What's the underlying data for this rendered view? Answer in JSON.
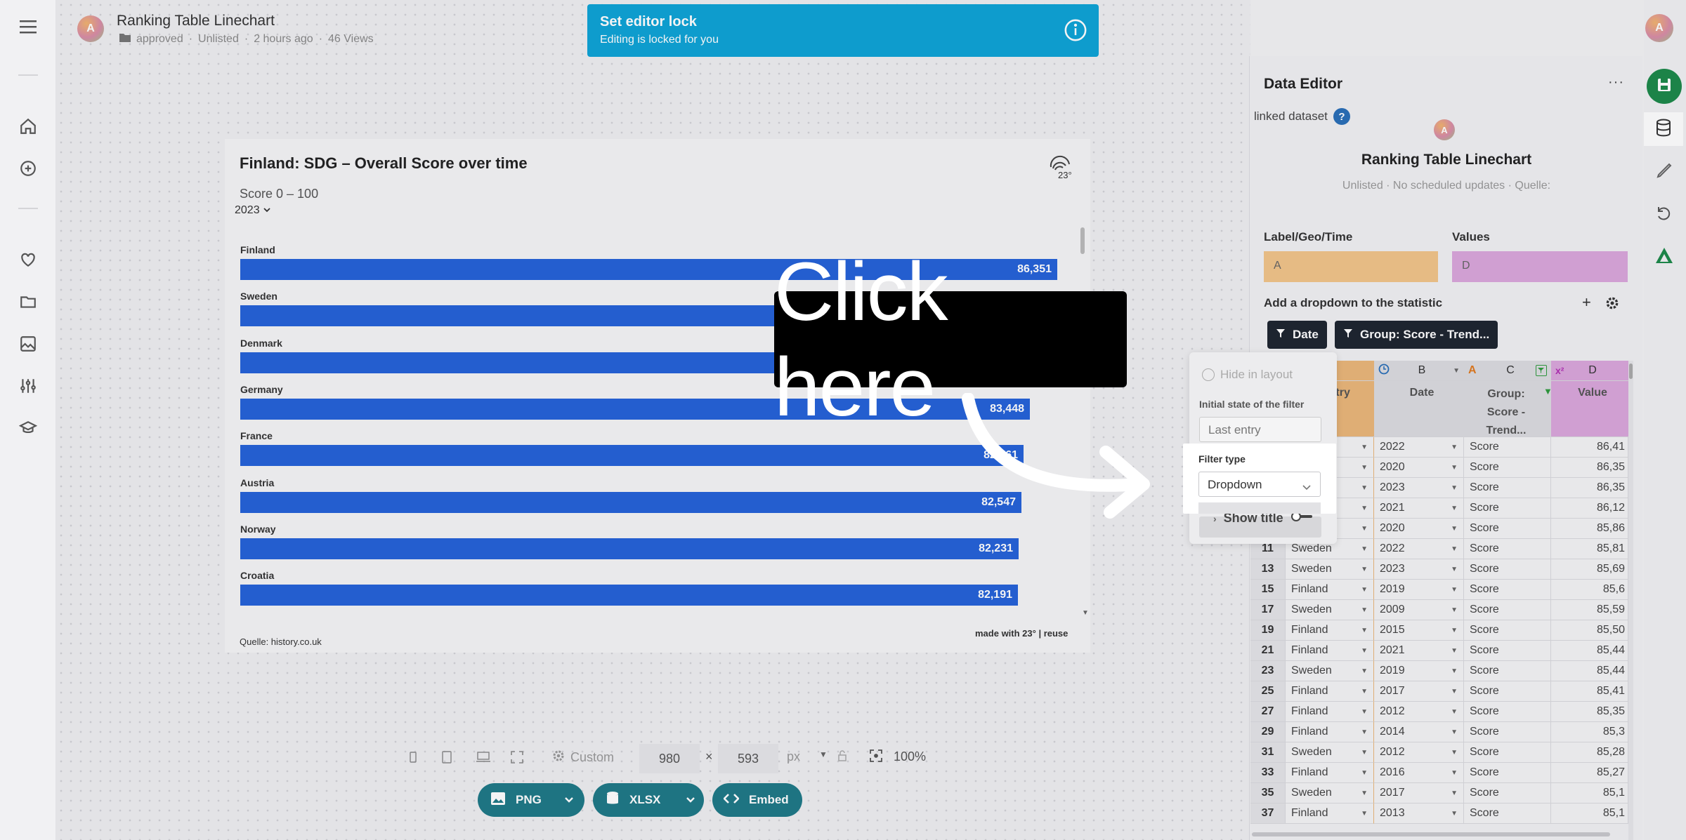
{
  "doc": {
    "title": "Ranking Table Linechart",
    "folder": "approved",
    "visibility": "Unlisted",
    "time": "2 hours ago",
    "views": "46 Views",
    "avatar_letter": "A"
  },
  "lock": {
    "title": "Set editor lock",
    "subtitle": "Editing is locked for you"
  },
  "chart": {
    "title": "Finland: SDG – Overall Score over time",
    "subtitle": "Score 0 – 100",
    "year": "2023",
    "source": "Quelle: history.co.uk",
    "made_with": "made with 23° | reuse"
  },
  "chart_data": {
    "type": "bar",
    "title": "Finland: SDG – Overall Score over time",
    "subtitle": "Score 0 – 100",
    "categories": [
      "Finland",
      "Sweden",
      "Denmark",
      "Germany",
      "France",
      "Austria",
      "Norway",
      "Croatia"
    ],
    "values": [
      86.351,
      85.9,
      85.7,
      83.448,
      82.761,
      82.547,
      82.231,
      82.191
    ],
    "value_labels": [
      "86,351",
      "",
      "",
      "83,448",
      "82,761",
      "82,547",
      "82,231",
      "82,191"
    ],
    "xlim": [
      0,
      87
    ],
    "bar_color": "#2563d9"
  },
  "toolbar": {
    "preset": "Custom",
    "width": "980",
    "height": "593",
    "unit": "px",
    "zoom": "100%",
    "png": "PNG",
    "xlsx": "XLSX",
    "embed": "Embed"
  },
  "panel": {
    "header": "Data Editor",
    "linked": "linked dataset",
    "help": "?",
    "avatar": "A",
    "name": "Ranking Table Linechart",
    "meta": "Unlisted · No scheduled updates · Quelle:",
    "label_geo": "Label/Geo/Time",
    "values": "Values",
    "label_value": "A",
    "values_value": "D",
    "add_dropdown": "Add a dropdown to the statistic",
    "plus": "+",
    "chips": [
      "Date",
      "Group: Score - Trend..."
    ]
  },
  "grid": {
    "cols": [
      {
        "letter": "A",
        "name": "ountry"
      },
      {
        "letter": "B",
        "name": "Date"
      },
      {
        "letter": "C",
        "name": "Group: Score - Trend..."
      },
      {
        "letter": "D",
        "name": "Value"
      }
    ],
    "rows": [
      {
        "n": "",
        "country": "",
        "date": "2022",
        "group": "Score",
        "value": "86,41"
      },
      {
        "n": "",
        "country": "",
        "date": "2020",
        "group": "Score",
        "value": "86,35"
      },
      {
        "n": "",
        "country": "",
        "date": "2023",
        "group": "Score",
        "value": "86,35"
      },
      {
        "n": "",
        "country": "",
        "date": "2021",
        "group": "Score",
        "value": "86,12"
      },
      {
        "n": "",
        "country": "n",
        "date": "2020",
        "group": "Score",
        "value": "85,86"
      },
      {
        "n": "11",
        "country": "Sweden",
        "date": "2022",
        "group": "Score",
        "value": "85,81"
      },
      {
        "n": "13",
        "country": "Sweden",
        "date": "2023",
        "group": "Score",
        "value": "85,69"
      },
      {
        "n": "15",
        "country": "Finland",
        "date": "2019",
        "group": "Score",
        "value": "85,6"
      },
      {
        "n": "17",
        "country": "Sweden",
        "date": "2009",
        "group": "Score",
        "value": "85,59"
      },
      {
        "n": "19",
        "country": "Finland",
        "date": "2015",
        "group": "Score",
        "value": "85,50"
      },
      {
        "n": "21",
        "country": "Finland",
        "date": "2021",
        "group": "Score",
        "value": "85,44"
      },
      {
        "n": "23",
        "country": "Sweden",
        "date": "2019",
        "group": "Score",
        "value": "85,44"
      },
      {
        "n": "25",
        "country": "Finland",
        "date": "2017",
        "group": "Score",
        "value": "85,41"
      },
      {
        "n": "27",
        "country": "Finland",
        "date": "2012",
        "group": "Score",
        "value": "85,35"
      },
      {
        "n": "29",
        "country": "Finland",
        "date": "2014",
        "group": "Score",
        "value": "85,3"
      },
      {
        "n": "31",
        "country": "Sweden",
        "date": "2012",
        "group": "Score",
        "value": "85,28"
      },
      {
        "n": "33",
        "country": "Finland",
        "date": "2016",
        "group": "Score",
        "value": "85,27"
      },
      {
        "n": "35",
        "country": "Sweden",
        "date": "2017",
        "group": "Score",
        "value": "85,1"
      },
      {
        "n": "37",
        "country": "Finland",
        "date": "2013",
        "group": "Score",
        "value": "85,1"
      }
    ]
  },
  "popup": {
    "hide": "Hide in layout",
    "initial_label": "Initial state of the filter",
    "initial_value": "Last entry",
    "filter_type": "Filter type",
    "filter_value": "Dropdown",
    "show_title": "Show title"
  },
  "overlay": {
    "text": "Click here"
  }
}
